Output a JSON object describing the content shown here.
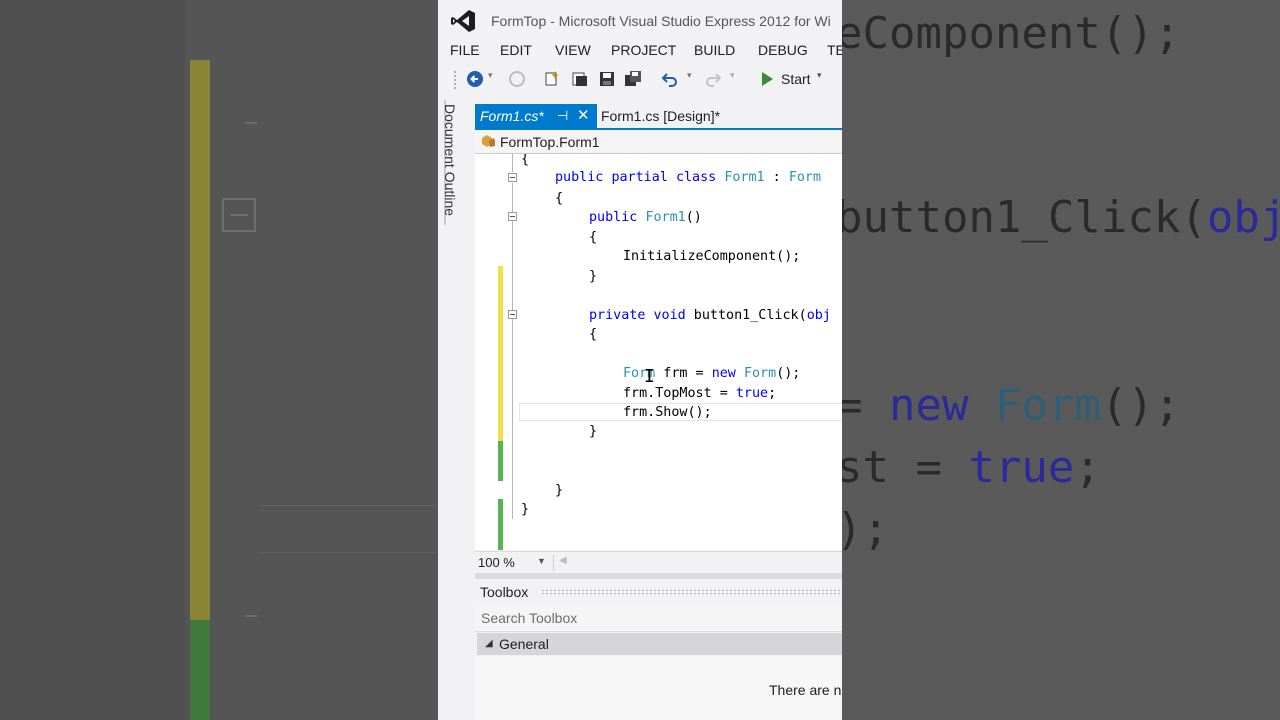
{
  "window": {
    "title": "FormTop - Microsoft Visual Studio Express 2012 for Wi"
  },
  "menu": [
    "FILE",
    "EDIT",
    "VIEW",
    "PROJECT",
    "BUILD",
    "DEBUG",
    "TE"
  ],
  "toolbar": {
    "start_label": "Start",
    "icons": [
      "back-icon",
      "forward-icon",
      "new-project-icon",
      "open-icon",
      "save-icon",
      "save-all-icon",
      "undo-icon",
      "redo-icon",
      "start-icon"
    ]
  },
  "side_panel": {
    "label": "Document Outline"
  },
  "tabs": [
    {
      "label": "Form1.cs*",
      "active": true
    },
    {
      "label": "Form1.cs [Design]*",
      "active": false
    }
  ],
  "navbar": {
    "type": "FormTop.Form1"
  },
  "code": {
    "lines": [
      {
        "segs": [
          [
            "p",
            "{"
          ]
        ]
      },
      {
        "segs": [
          [
            "k",
            "public"
          ],
          [
            "p",
            " "
          ],
          [
            "k",
            "partial"
          ],
          [
            "p",
            " "
          ],
          [
            "k",
            "class"
          ],
          [
            "p",
            " "
          ],
          [
            "t",
            "Form1"
          ],
          [
            "p",
            " : "
          ],
          [
            "t",
            "Form"
          ]
        ]
      },
      {
        "segs": [
          [
            "p",
            "{"
          ]
        ]
      },
      {
        "segs": [
          [
            "k",
            "public"
          ],
          [
            "p",
            " "
          ],
          [
            "t",
            "Form1"
          ],
          [
            "p",
            "()"
          ]
        ]
      },
      {
        "segs": [
          [
            "p",
            "{"
          ]
        ]
      },
      {
        "segs": [
          [
            "p",
            "InitializeComponent();"
          ]
        ]
      },
      {
        "segs": [
          [
            "p",
            "}"
          ]
        ]
      },
      {
        "segs": [
          [
            "k",
            "private"
          ],
          [
            "p",
            " "
          ],
          [
            "k",
            "void"
          ],
          [
            "p",
            " button1_Click("
          ],
          [
            "k",
            "obj"
          ]
        ]
      },
      {
        "segs": [
          [
            "p",
            "{"
          ]
        ]
      },
      {
        "segs": [
          [
            "t",
            "Form"
          ],
          [
            "p",
            " frm = "
          ],
          [
            "k",
            "new"
          ],
          [
            "p",
            " "
          ],
          [
            "t",
            "Form"
          ],
          [
            "p",
            "();"
          ]
        ]
      },
      {
        "segs": [
          [
            "p",
            "frm.TopMost = "
          ],
          [
            "k",
            "true"
          ],
          [
            "p",
            ";"
          ]
        ]
      },
      {
        "segs": [
          [
            "p",
            "frm.Show();"
          ]
        ]
      },
      {
        "segs": [
          [
            "p",
            "}"
          ]
        ]
      },
      {
        "segs": [
          [
            "p",
            "}"
          ]
        ]
      },
      {
        "segs": [
          [
            "p",
            "}"
          ]
        ]
      }
    ]
  },
  "zoom": {
    "value": "100 %"
  },
  "toolbox": {
    "title": "Toolbox",
    "search_placeholder": "Search Toolbox",
    "group": "General",
    "empty_message": "There are n"
  },
  "background_zoom": {
    "lines": [
      [
        [
          "p",
          "eComponent();"
        ]
      ],
      [
        [
          "p",
          "button1_Click("
        ],
        [
          "k",
          "obj"
        ]
      ],
      [
        [
          "p",
          "= "
        ],
        [
          "k",
          "new"
        ],
        [
          "p",
          " "
        ],
        [
          "t",
          "Form"
        ],
        [
          "p",
          "();"
        ]
      ],
      [
        [
          "p",
          "st = "
        ],
        [
          "k",
          "true"
        ],
        [
          "p",
          ";"
        ]
      ],
      [
        [
          "p",
          ");"
        ]
      ]
    ]
  },
  "colors": {
    "accent": "#007acc",
    "keyword": "#0000ff",
    "type": "#2b91af",
    "change_saved": "#57b44e",
    "change_unsaved": "#f0e04a"
  }
}
